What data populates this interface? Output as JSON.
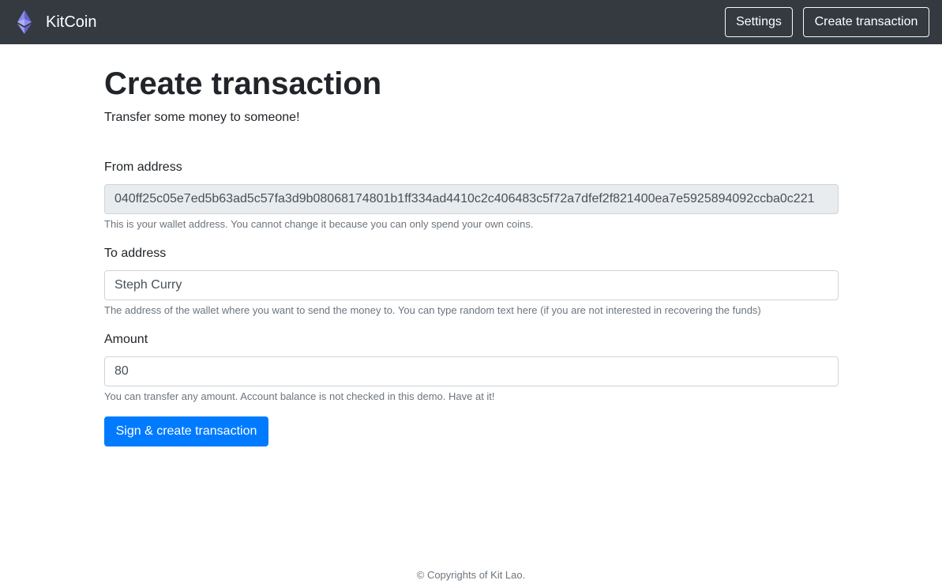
{
  "navbar": {
    "brand": "KitCoin",
    "brand_icon": "ethereum-logo-icon",
    "settings_label": "Settings",
    "create_label": "Create transaction"
  },
  "page": {
    "title": "Create transaction",
    "lead": "Transfer some money to someone!"
  },
  "form": {
    "from": {
      "label": "From address",
      "value": "040ff25c05e7ed5b63ad5c57fa3d9b08068174801b1ff334ad4410c2c406483c5f72a7dfef2f821400ea7e5925894092ccba0c221",
      "help": "This is your wallet address. You cannot change it because you can only spend your own coins."
    },
    "to": {
      "label": "To address",
      "value": "Steph Curry",
      "help": "The address of the wallet where you want to send the money to. You can type random text here (if you are not interested in recovering the funds)"
    },
    "amount": {
      "label": "Amount",
      "value": "80",
      "help": "You can transfer any amount. Account balance is not checked in this demo. Have at it!"
    },
    "submit_label": "Sign & create transaction"
  },
  "footer": {
    "text": "© Copyrights of Kit Lao."
  },
  "colors": {
    "navbar_bg": "#343a40",
    "primary": "#007bff",
    "readonly_bg": "#e9ecef",
    "muted_text": "#6c757d"
  }
}
